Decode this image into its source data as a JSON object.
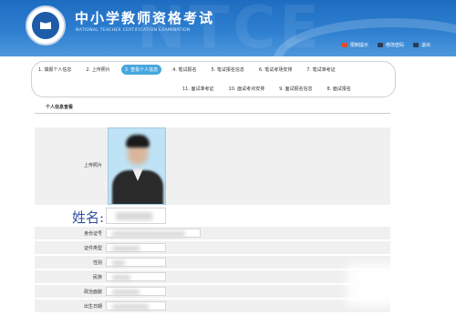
{
  "header": {
    "site_title": "中小学教师资格考试",
    "site_subtitle": "NATIONAL TEACHER CERTIFICATION EXAMINATION",
    "watermark": "NTCE",
    "links": [
      {
        "label": "限制提示",
        "icon": "alert-icon",
        "color": "#e24b2a"
      },
      {
        "label": "修改密码",
        "icon": "key-icon",
        "color": "#2b3a55"
      },
      {
        "label": "退出",
        "icon": "exit-icon",
        "color": "#2b3a55"
      }
    ]
  },
  "steps_row1": [
    {
      "label": "1. 填报个人信息",
      "active": false
    },
    {
      "label": "2. 上传照片",
      "active": false
    },
    {
      "label": "3. 查看个人信息",
      "active": true
    },
    {
      "label": "4. 笔试报名",
      "active": false
    },
    {
      "label": "5. 笔试报名信息",
      "active": false
    },
    {
      "label": "6. 笔试考场安排",
      "active": false
    },
    {
      "label": "7. 笔试准考证",
      "active": false
    }
  ],
  "steps_row2": [
    {
      "label": "11. 面试准考证",
      "active": false
    },
    {
      "label": "10. 面试考点安排",
      "active": false
    },
    {
      "label": "9. 面试报名信息",
      "active": false
    },
    {
      "label": "8. 面试报名",
      "active": false
    }
  ],
  "section": {
    "title": "个人信息查看"
  },
  "form": {
    "photo_label": "上传照片",
    "name_label": "姓名:",
    "id_label": "身份证号",
    "cert_type_label": "证件类型",
    "gender_label": "性别",
    "ethnicity_label": "民族",
    "political_label": "政治面貌",
    "birth_label": "出生日期"
  },
  "colors": {
    "accent": "#46a6dd",
    "header": "#2e7fd0",
    "row_bg": "#f0f0f0"
  }
}
